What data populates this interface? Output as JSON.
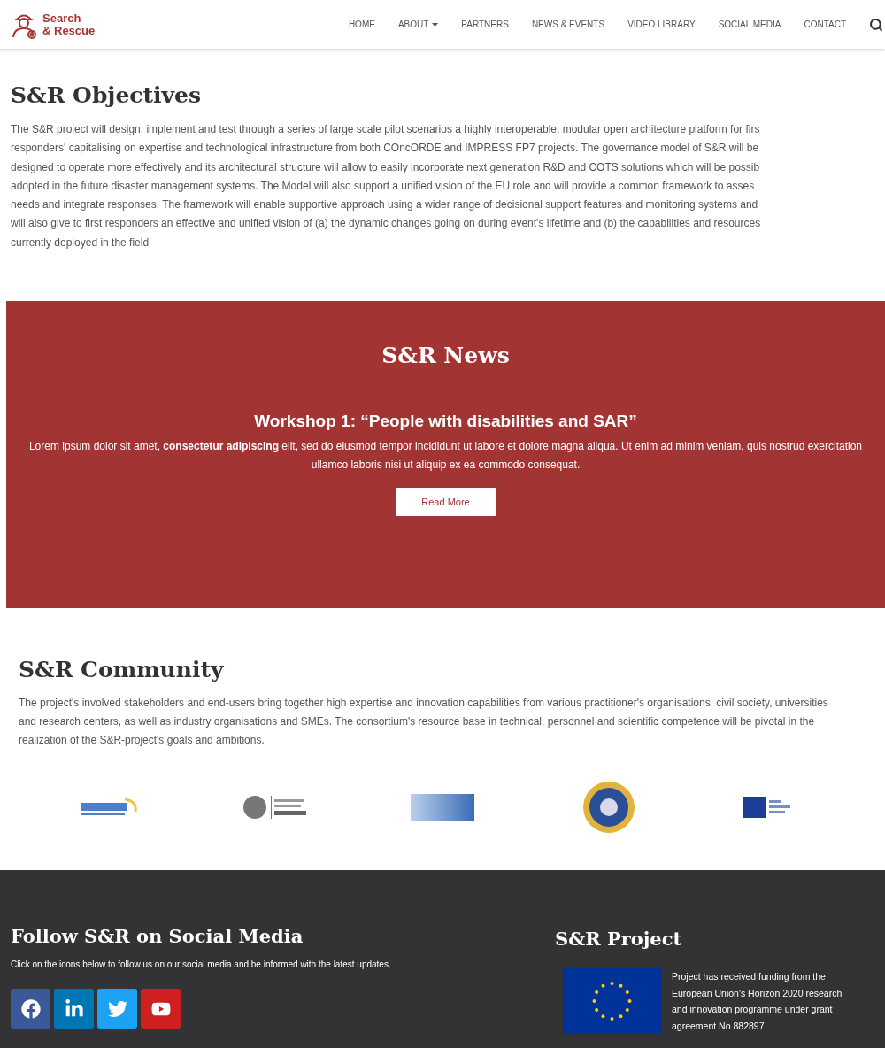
{
  "header": {
    "logo_lines": [
      "Search",
      "& Rescue"
    ],
    "nav": [
      {
        "label": "HOME",
        "dropdown": false
      },
      {
        "label": "ABOUT",
        "dropdown": true
      },
      {
        "label": "PARTNERS",
        "dropdown": false
      },
      {
        "label": "NEWS & EVENTS",
        "dropdown": false
      },
      {
        "label": "VIDEO LIBRARY",
        "dropdown": false
      },
      {
        "label": "SOCIAL MEDIA",
        "dropdown": false
      },
      {
        "label": "CONTACT",
        "dropdown": false
      }
    ]
  },
  "objectives": {
    "title": "S&R Objectives",
    "lines": [
      "The S&R project will design, implement and test through a series of large scale pilot scenarios a highly interoperable, modular open architecture platform for firs",
      "responders' capitalising on expertise and technological infrastructure from both COncORDE and IMPRESS FP7 projects. The governance model of S&R will be",
      "designed to operate more effectively and its architectural structure will allow to easily incorporate next generation R&D and COTS solutions which will be possib",
      "adopted in the future disaster management systems. The Model will also support a unified vision of the EU role and will provide a common framework to asses",
      "needs and integrate responses. The framework will enable supportive approach using a wider range of decisional support features and monitoring systems and",
      "will also give to first responders an effective and unified vision of (a) the dynamic changes going on during event's lifetime and (b) the capabilities and resources",
      "currently deployed in the field"
    ]
  },
  "news": {
    "title": "S&R News",
    "article_title": "Workshop 1: “People with disabilities and SAR”",
    "text": "Lorem ipsum dolor sit amet, **consectetur adipiscing** elit, sed do eiusmod tempor incididunt ut labore et dolore magna aliqua. Ut enim ad minim veniam, quis nostrud exercitation ullamco laboris nisi ut aliquip ex ea commodo consequat.",
    "button": "Read More"
  },
  "community": {
    "title": "S&R Community",
    "text": "The project's involved stakeholders and end-users bring together high expertise and innovation capabilities from various practitioner's organisations, civil society, universities and research centers, as well as industry organisations and SMEs. The consortium's resource base in technical, personnel and scientific competence will be pivotal in the realization of the S&R-project's goals and ambitions.",
    "partners": [
      {
        "kind": "wordmark"
      },
      {
        "kind": "crest"
      },
      {
        "kind": "block"
      },
      {
        "kind": "seal"
      },
      {
        "kind": "square"
      }
    ]
  },
  "footer": {
    "social": {
      "title": "Follow S&R on Social Media",
      "text": "Click on the icons below to follow us on our social media and be informed with the latest updates.",
      "icons": [
        {
          "kind": "facebook",
          "color": "#3b5998"
        },
        {
          "kind": "linkedin",
          "color": "#0077b5"
        },
        {
          "kind": "twitter",
          "color": "#1da1f2"
        },
        {
          "kind": "youtube",
          "color": "#cd201f"
        }
      ]
    },
    "project": {
      "title": "S&R Project",
      "text": "Project has received funding from the European Union's Horizon 2020 research and innovation programme under grant agreement No 882897"
    }
  }
}
